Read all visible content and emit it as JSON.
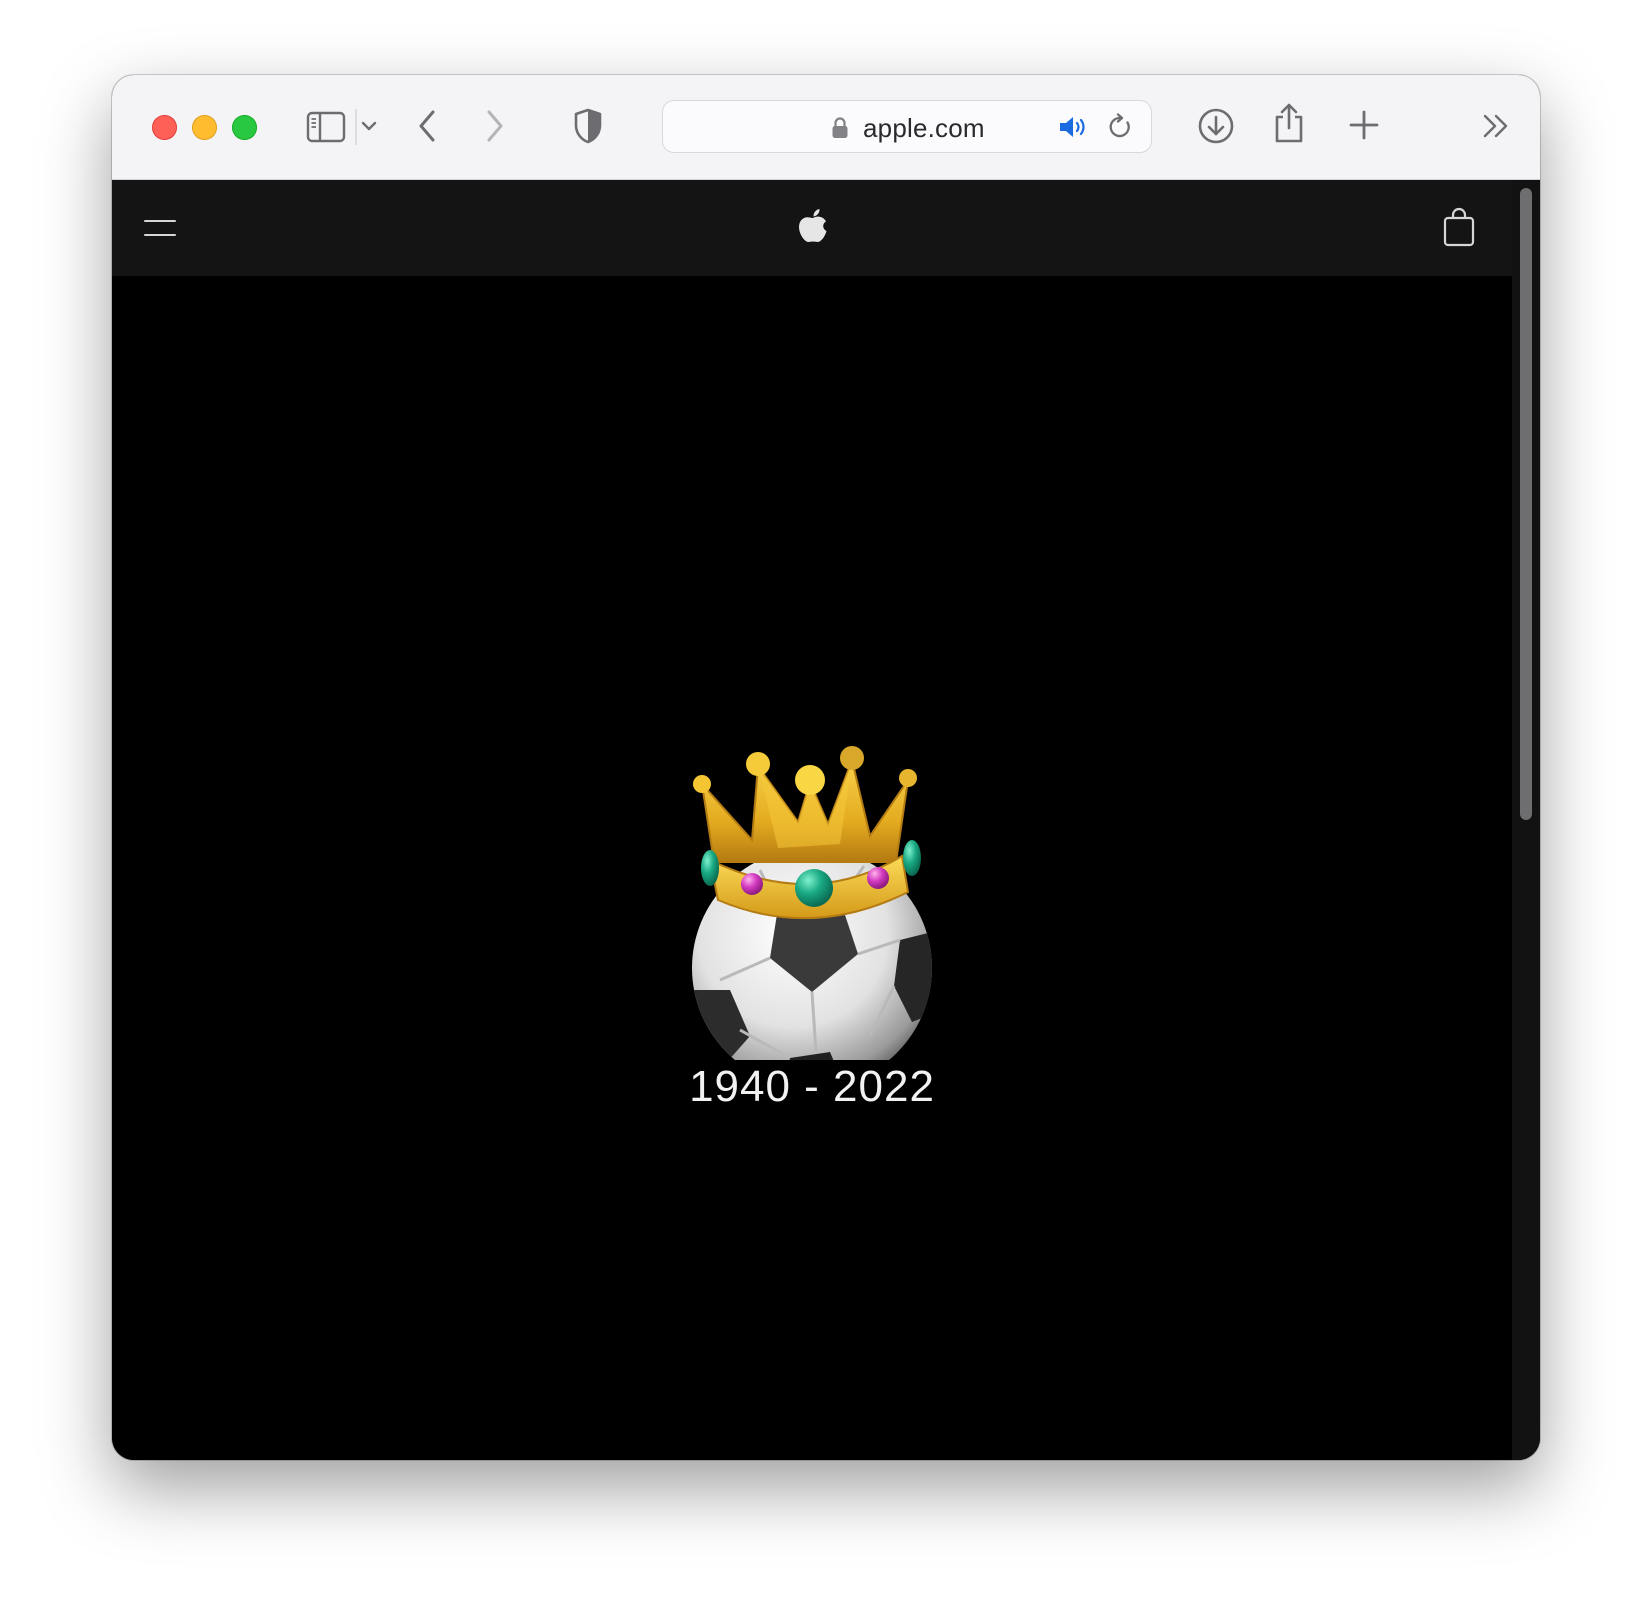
{
  "browser": {
    "url": "apple.com",
    "colors": {
      "toolbar": "#f4f3f6",
      "audio_icon": "#1a6ae0"
    },
    "icons": [
      "sidebar-icon",
      "chevron-down-icon",
      "back-chevron-icon",
      "forward-chevron-icon",
      "shield-icon",
      "lock-icon",
      "speaker-icon",
      "reload-icon",
      "download-icon",
      "share-icon",
      "plus-icon",
      "double-chevron-right-icon"
    ]
  },
  "page": {
    "dates": "1940 - 2022",
    "icons": [
      "menu-icon",
      "apple-logo-icon",
      "shopping-bag-icon",
      "crown-soccer-ball-emoji"
    ],
    "colors": {
      "background": "#000000",
      "nav": "#141414",
      "text": "#f2f2f2"
    }
  }
}
